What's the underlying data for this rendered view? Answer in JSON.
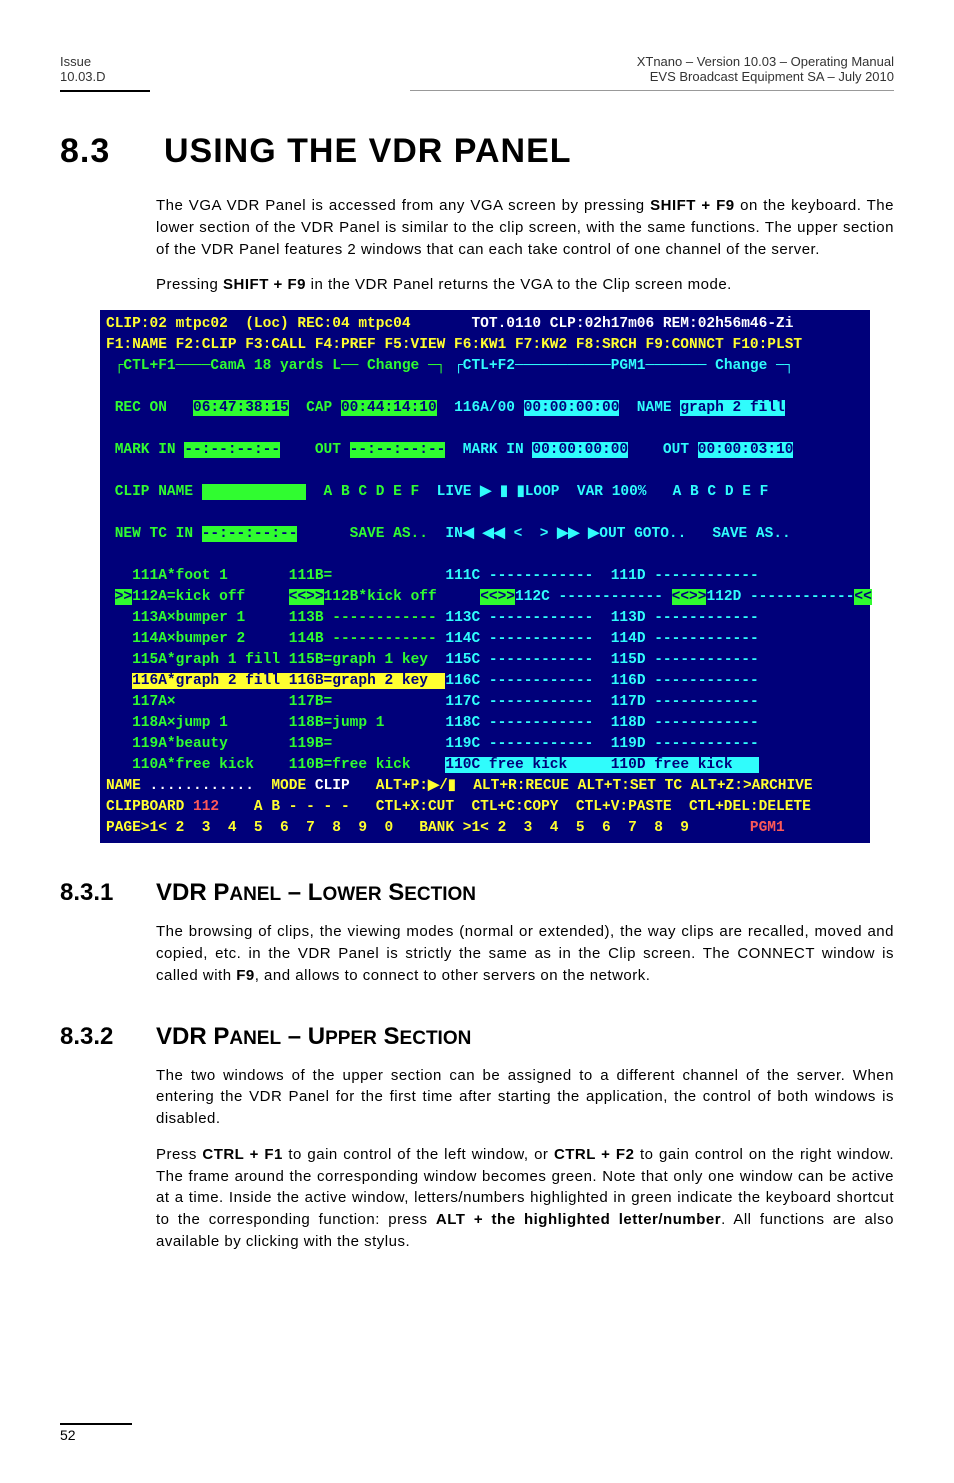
{
  "header": {
    "left_line1": "Issue",
    "left_line2": "10.03.D",
    "right_line1": "XTnano – Version 10.03 – Operating Manual",
    "right_line2": "EVS Broadcast Equipment SA – July 2010"
  },
  "section": {
    "number": "8.3",
    "title": "USING THE VDR PANEL"
  },
  "intro_p1_a": "The VGA VDR Panel is accessed from any VGA screen by pressing ",
  "intro_p1_bold": "SHIFT + F9",
  "intro_p1_b": " on the keyboard. The lower section of the VDR Panel is similar to the clip screen, with the same functions. The upper section of the VDR Panel features 2 windows that can each take control of one channel of the server.",
  "intro_p2_a": "Pressing ",
  "intro_p2_bold": "SHIFT + F9",
  "intro_p2_b": " in the VDR Panel returns the VGA to the Clip screen mode.",
  "terminal": {
    "l01_a": "CLIP:02 mtpc02  (Loc) REC:04 mtpc04       ",
    "l01_b": "TOT.0110 CLP:02h17m06 REM:02h56m46-Zi",
    "l02": "F1:NAME F2:CLIP F3:CALL F4:PREF F5:VIEW F6:KW1 F7:KW2 F8:SRCH F9:CONNCT F10:PLST",
    "l03_a": " ┌CTL+F1────CamA 18 yards L── C",
    "l03_h": "hange ─┐",
    "l03_b": " ┌CTL+F2───────────PGM1─────── C",
    "l03_b2": "hange ─┐",
    "l04_a": " REC ON   ",
    "l04_tc1": "06:47:38:15",
    "l04_b": "  CAP ",
    "l04_tc2": "00:44:14:10",
    "l04_c": "  116A/00 ",
    "l04_tc3": "00:00:00:00",
    "l04_d": "  NAME ",
    "l04_e": "graph 2 fill",
    "l05_a": " MARK IN ",
    "l05_tc1": "--:--:--:--",
    "l05_b": "    OUT ",
    "l05_tc2": "--:--:--:--",
    "l05_c": "  MARK IN ",
    "l05_tc3": "00:00:00:00",
    "l05_d": "    OUT ",
    "l05_tc4": "00:00:03:10",
    "l06_a": " CLIP NAME ",
    "l06_sp": "            ",
    "l06_b": "A B C D E F",
    "l06_c": "  LIVE ▶ ▮ ▮LOOP  VAR 100%   A B C D E F",
    "l07_a": " NEW TC IN ",
    "l07_tc": "--:--:--:--",
    "l07_b": "      SAVE AS..",
    "l07_c": "  IN◀ ◀◀ <  > ▶▶ ▶OUT GOTO..   SAVE AS..",
    "rows": [
      {
        "a": "111A*foot 1       ",
        "b": "111B=             ",
        "c": "111C ------------  111D ------------"
      },
      {
        "a": "112A=kick off     ",
        "b": "112B*kick off     ",
        "c": "112C ------------  112D ------------",
        "mark": true
      },
      {
        "a": "113A×bumper 1     ",
        "b": "113B ------------ ",
        "c": "113C ------------  113D ------------"
      },
      {
        "a": "114A×bumper 2     ",
        "b": "114B ------------ ",
        "c": "114C ------------  114D ------------"
      },
      {
        "a": "115A*graph 1 fill ",
        "b": "115B=graph 1 key  ",
        "c": "115C ------------  115D ------------"
      },
      {
        "a": "116A*graph 2 fill ",
        "b": "116B=graph 2 key  ",
        "c": "116C ------------  116D ------------",
        "sel": true
      },
      {
        "a": "117A×             ",
        "b": "117B=             ",
        "c": "117C ------------  117D ------------"
      },
      {
        "a": "118A×jump 1       ",
        "b": "118B=jump 1       ",
        "c": "118C ------------  118D ------------"
      },
      {
        "a": "119A*beauty       ",
        "b": "119B=             ",
        "c": "119C ------------  119D ------------"
      },
      {
        "a": "110A*free kick    ",
        "b": "110B=free kick    ",
        "c": "110C free kick     110D free kick   ",
        "last": true
      }
    ],
    "f1_a": "NAME ",
    "f1_b": "............",
    "f1_c": "  MODE ",
    "f1_d": "CLIP",
    "f1_e": "   ALT+P:▶/▮  ALT+R:RECUE ALT+T:SET TC ALT+Z:>ARCHIVE",
    "f2_a": "CLIPBOARD ",
    "f2_b": "112",
    "f2_c": "    A B - - - -   CTL+X:CUT  CTL+C:COPY  CTL+V:PASTE  CTL+DEL:DELETE",
    "f3_a": "PAGE>1< 2  3  4  5  6  7  8  9  0   BANK >1< 2  3  4  5  6  7  8  9       ",
    "f3_b": "PGM1"
  },
  "sub1": {
    "number": "8.3.1",
    "title_a": "VDR P",
    "title_b": "ANEL",
    "title_c": " – L",
    "title_d": "OWER",
    "title_e": " S",
    "title_f": "ECTION",
    "p_a": "The browsing of clips, the viewing modes (normal or extended), the way clips are recalled, moved and copied, etc. in the VDR Panel is strictly the same as in the Clip screen. The CONNECT window is called with ",
    "p_bold": "F9",
    "p_b": ", and allows to connect to other servers on the network."
  },
  "sub2": {
    "number": "8.3.2",
    "title_a": "VDR P",
    "title_b": "ANEL",
    "title_c": " – U",
    "title_d": "PPER",
    "title_e": " S",
    "title_f": "ECTION",
    "p1": "The two windows of the upper section can be assigned to a different channel of the server. When entering the VDR Panel for the first time after starting the application, the control of both windows is disabled.",
    "p2_a": "Press ",
    "p2_b1": "CTRL + F1",
    "p2_c": " to gain control of the left window, or ",
    "p2_b2": "CTRL + F2",
    "p2_d": " to gain control on the right window.  The frame around the corresponding window becomes green. Note that only one window can be active at a time. Inside the active window, letters/numbers highlighted in green indicate the keyboard shortcut to the corresponding function: press ",
    "p2_b3": "ALT + the highlighted letter/number",
    "p2_e": ". All functions are also available by clicking with the stylus."
  },
  "footer_page": "52"
}
